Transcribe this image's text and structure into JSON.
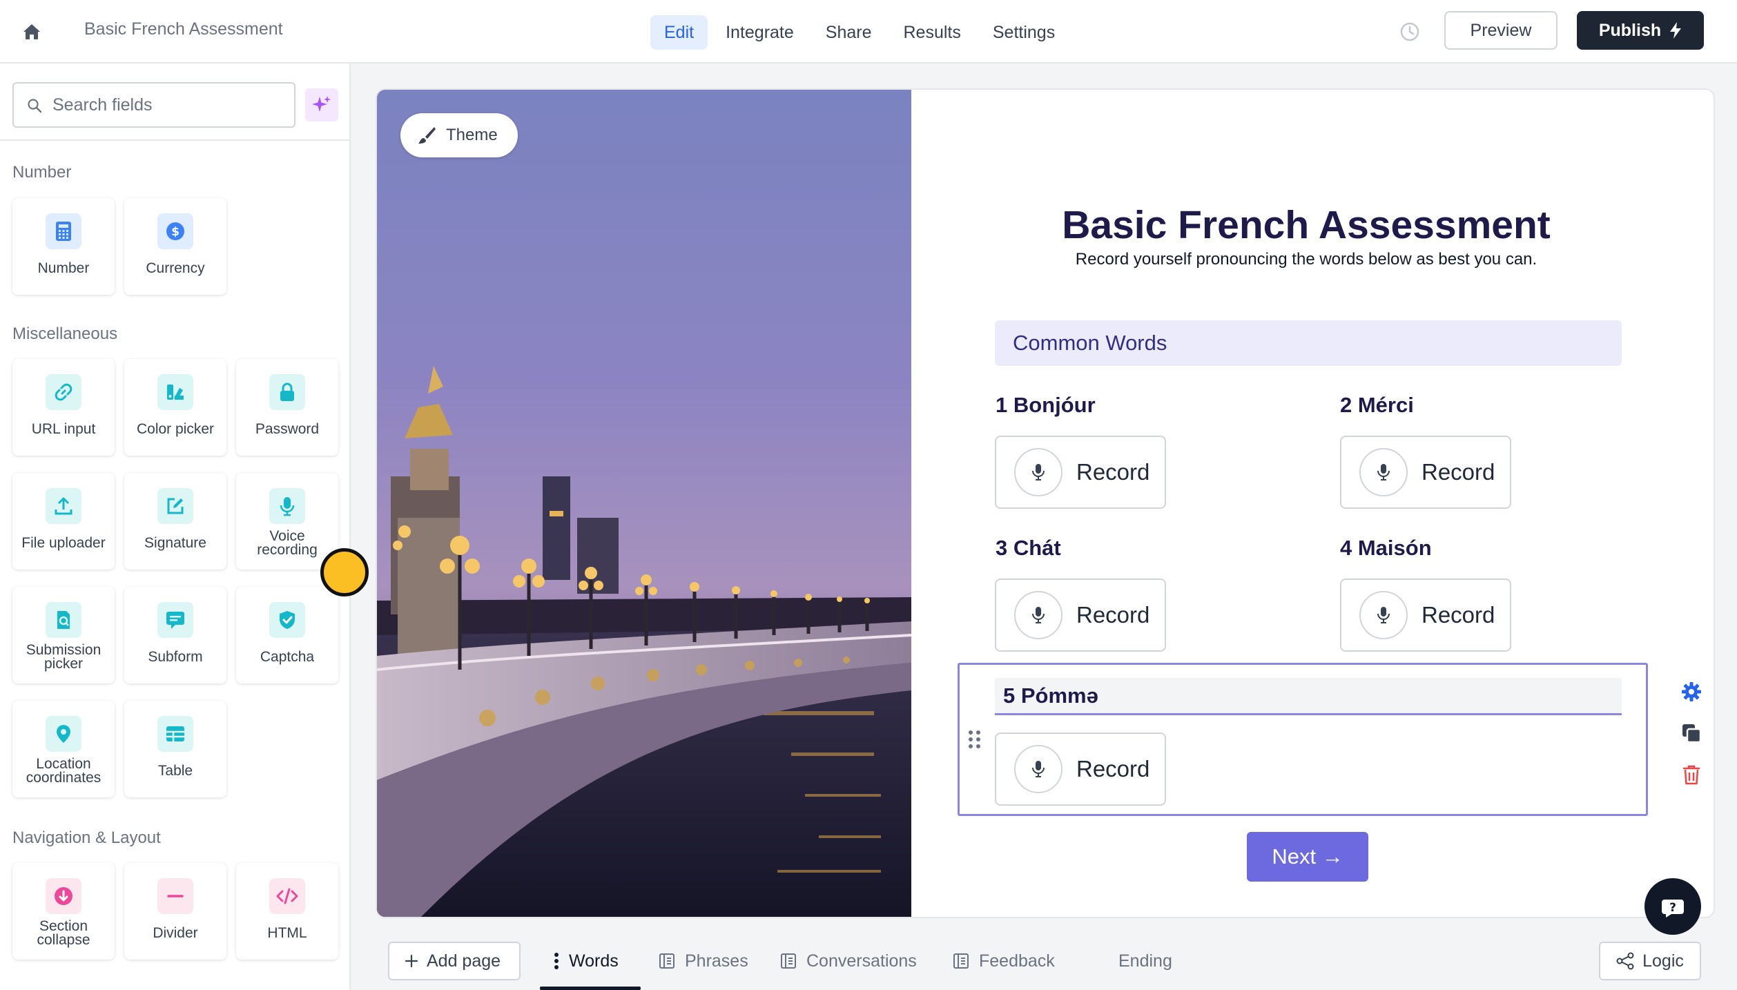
{
  "topbar": {
    "title": "Basic French Assessment",
    "tabs": [
      {
        "label": "Edit",
        "active": true
      },
      {
        "label": "Integrate"
      },
      {
        "label": "Share"
      },
      {
        "label": "Results"
      },
      {
        "label": "Settings"
      }
    ],
    "preview_label": "Preview",
    "publish_label": "Publish"
  },
  "sidebar": {
    "search_placeholder": "Search fields",
    "sections": {
      "number": {
        "title": "Number",
        "items": [
          {
            "label": "Number",
            "icon": "calculator-icon"
          },
          {
            "label": "Currency",
            "icon": "dollar-icon"
          }
        ]
      },
      "misc": {
        "title": "Miscellaneous",
        "items": [
          {
            "label": "URL input",
            "icon": "link-icon"
          },
          {
            "label": "Color picker",
            "icon": "palette-icon"
          },
          {
            "label": "Password",
            "icon": "lock-icon"
          },
          {
            "label": "File uploader",
            "icon": "upload-icon"
          },
          {
            "label": "Signature",
            "icon": "signature-icon"
          },
          {
            "label": "Voice recording",
            "icon": "microphone-icon"
          },
          {
            "label": "Submission picker",
            "icon": "submission-icon"
          },
          {
            "label": "Subform",
            "icon": "subform-icon"
          },
          {
            "label": "Captcha",
            "icon": "shield-check-icon"
          },
          {
            "label": "Location coordinates",
            "icon": "location-pin-icon"
          },
          {
            "label": "Table",
            "icon": "table-icon"
          }
        ]
      },
      "nav": {
        "title": "Navigation & Layout",
        "items": [
          {
            "label": "Section collapse",
            "icon": "collapse-icon"
          },
          {
            "label": "Divider",
            "icon": "divider-icon"
          },
          {
            "label": "HTML",
            "icon": "code-icon"
          }
        ]
      }
    }
  },
  "form": {
    "theme_label": "Theme",
    "title": "Basic French Assessment",
    "subtitle": "Record yourself pronouncing the words below as best you can.",
    "section_title": "Common Words",
    "questions": [
      {
        "label": "1 Bonjóur",
        "button": "Record"
      },
      {
        "label": "2 Mérci",
        "button": "Record"
      },
      {
        "label": "3 Chát",
        "button": "Record"
      },
      {
        "label": "4 Maisón",
        "button": "Record"
      },
      {
        "label": "5 Pómmə",
        "button": "Record"
      }
    ],
    "next_label": "Next →"
  },
  "pages": {
    "add_label": "Add page",
    "tabs": [
      {
        "label": "Words",
        "active": true
      },
      {
        "label": "Phrases"
      },
      {
        "label": "Conversations"
      },
      {
        "label": "Feedback"
      },
      {
        "label": "Ending"
      }
    ],
    "logic_label": "Logic"
  },
  "colors": {
    "accent": "#2563eb",
    "brand_dark": "#1e2634",
    "next_button": "#6d6ae0",
    "section_bar": "#ecebfb",
    "selection_outline": "#8b86e0"
  }
}
